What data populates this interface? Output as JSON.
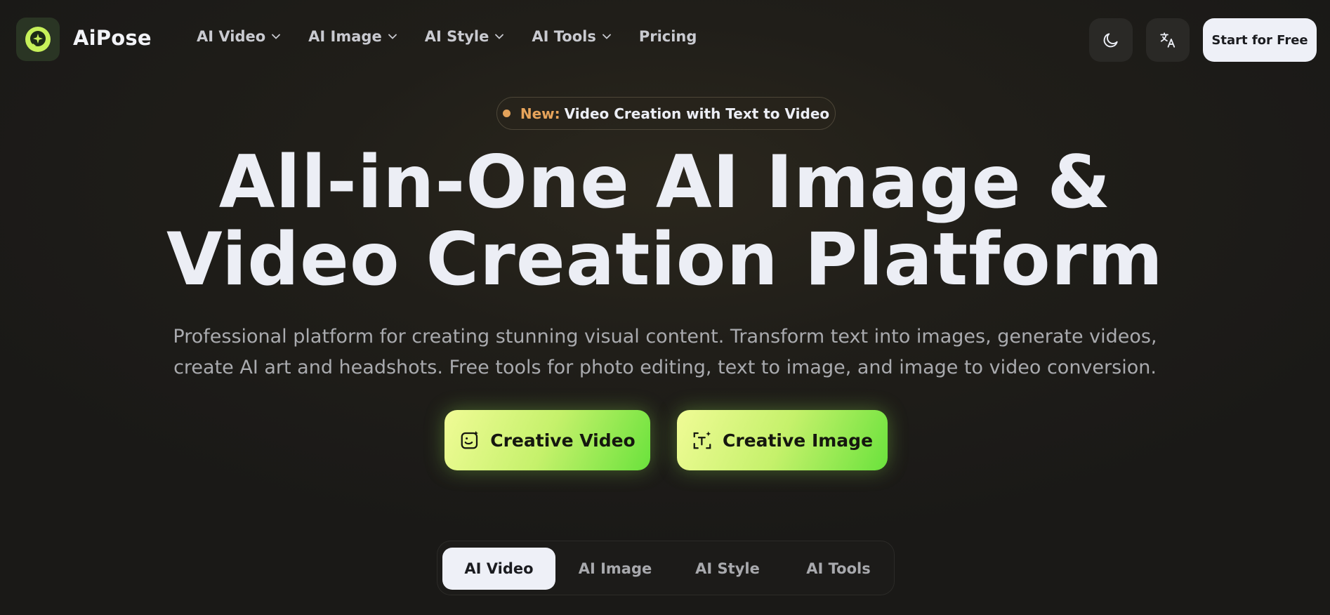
{
  "header": {
    "brand": "AiPose",
    "nav": [
      {
        "label": "AI Video",
        "has_dropdown": true
      },
      {
        "label": "AI Image",
        "has_dropdown": true
      },
      {
        "label": "AI Style",
        "has_dropdown": true
      },
      {
        "label": "AI Tools",
        "has_dropdown": true
      },
      {
        "label": "Pricing",
        "has_dropdown": false
      }
    ],
    "theme_icon": "moon-icon",
    "language_icon": "translate-icon",
    "start_label": "Start for Free"
  },
  "hero": {
    "badge_new": "New:",
    "badge_text": "Video Creation with Text to Video",
    "headline_line1": "All-in-One AI Image &",
    "headline_line2": "Video Creation Platform",
    "subtext_line1": "Professional platform for creating stunning visual content. Transform text into images, generate videos,",
    "subtext_line2": "create AI art and headshots. Free tools for photo editing, text to image, and image to video conversion.",
    "cta_video": "Creative Video",
    "cta_image": "Creative Image"
  },
  "tabs": [
    {
      "label": "AI Video",
      "active": true
    },
    {
      "label": "AI Image",
      "active": false
    },
    {
      "label": "AI Style",
      "active": false
    },
    {
      "label": "AI Tools",
      "active": false
    }
  ],
  "colors": {
    "accent_green": "#b8f05e",
    "badge_orange": "#e7a45b",
    "background": "#1f1d19",
    "text_light": "#eceef5"
  }
}
